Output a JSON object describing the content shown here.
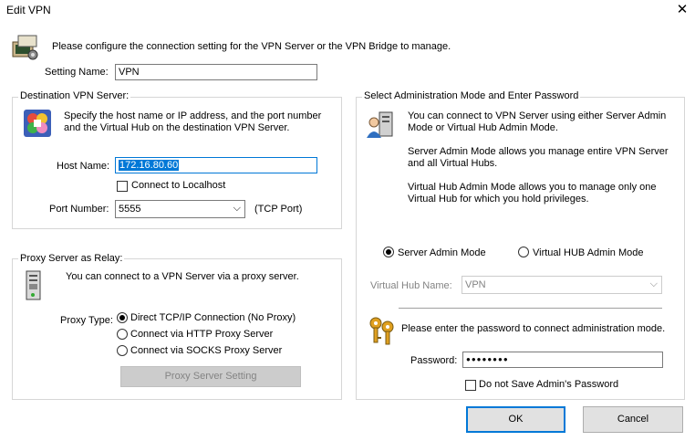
{
  "window": {
    "title": "Edit VPN",
    "close_glyph": "✕"
  },
  "intro": "Please configure the connection setting for the VPN Server or the VPN Bridge to manage.",
  "setting_name": {
    "label": "Setting Name:",
    "value": "VPN"
  },
  "destination": {
    "group_label": "Destination VPN Server:",
    "description": "Specify the host name or IP address, and the port number and the Virtual Hub on the destination VPN Server.",
    "host_label": "Host Name:",
    "host_value": "172.16.80.60",
    "localhost_label": "Connect to Localhost",
    "port_label": "Port Number:",
    "port_value": "5555",
    "port_unit": "(TCP Port)"
  },
  "proxy": {
    "group_label": "Proxy Server as Relay:",
    "description": "You can connect to a VPN Server via a proxy server.",
    "type_label": "Proxy Type:",
    "options": [
      "Direct TCP/IP Connection (No Proxy)",
      "Connect via HTTP Proxy Server",
      "Connect via SOCKS Proxy Server"
    ],
    "setting_button": "Proxy Server Setting"
  },
  "admin": {
    "group_label": "Select Administration Mode and Enter Password",
    "description1": "You can connect to VPN Server using either Server Admin Mode or Virtual Hub Admin Mode.",
    "description2": "Server Admin Mode allows you manage entire VPN Server and all Virtual Hubs.",
    "description3": "Virtual Hub Admin Mode allows you to manage only one Virtual Hub for which you hold privileges.",
    "mode_server": "Server Admin Mode",
    "mode_hub": "Virtual HUB Admin Mode",
    "hub_label": "Virtual Hub Name:",
    "hub_value": "VPN",
    "password_prompt": "Please enter the password to connect administration mode.",
    "password_label": "Password:",
    "password_value": "●●●●●●●●",
    "no_save_label": "Do not Save Admin's Password"
  },
  "buttons": {
    "ok": "OK",
    "cancel": "Cancel"
  },
  "icons": [
    "computer-settings-icon",
    "vpn-server-icon",
    "admin-user-icon",
    "proxy-server-icon",
    "keys-icon"
  ]
}
